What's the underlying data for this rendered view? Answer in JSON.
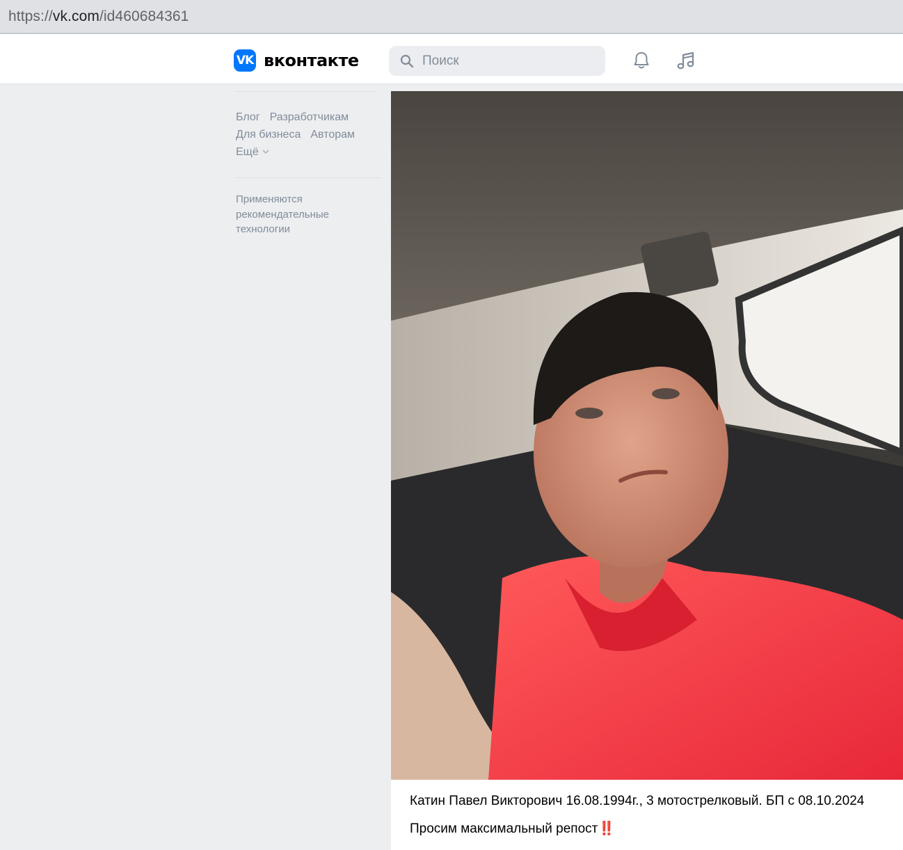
{
  "browser": {
    "url_scheme": "https://",
    "url_domain": "vk.com",
    "url_path": "/id460684361"
  },
  "header": {
    "logo_mark": "VK",
    "logo_text": "вконтакте",
    "search_placeholder": "Поиск",
    "icons": [
      "search-icon",
      "bell-icon",
      "music-icon"
    ]
  },
  "sidebar": {
    "links": [
      "Блог",
      "Разработчикам",
      "Для бизнеса",
      "Авторам"
    ],
    "more_label": "Ещё",
    "note": "Применяются рекомендательные технологии"
  },
  "post": {
    "caption_line1": "Катин Павел Викторович 16.08.1994г., 3 мотострелковый. БП с 08.10.2024",
    "caption_line2": "Просим максимальный репост",
    "emoji": "‼️"
  },
  "colors": {
    "brand": "#0077ff",
    "page_bg": "#edeef0",
    "muted_text": "#818c99"
  }
}
